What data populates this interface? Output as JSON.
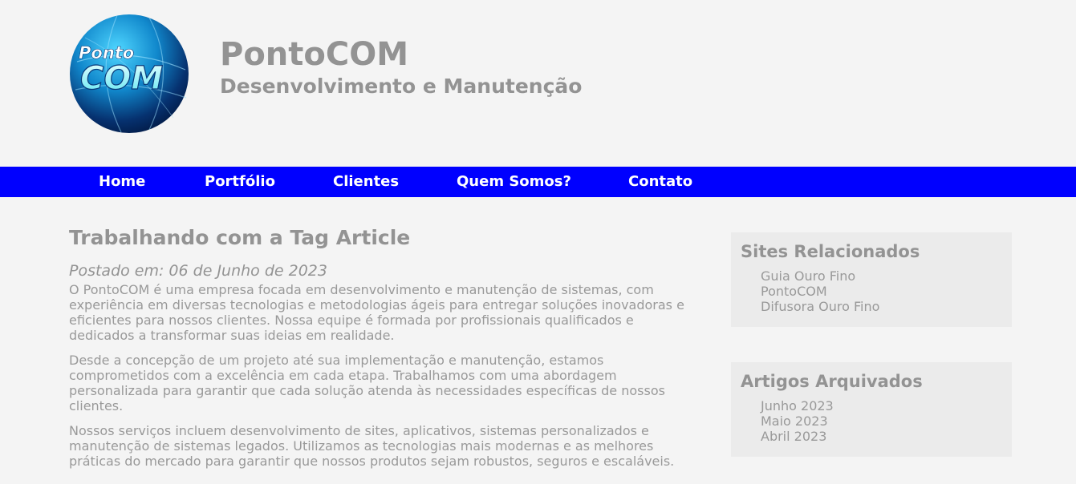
{
  "header": {
    "logo": {
      "line1": "Ponto",
      "line2": "COM"
    },
    "title": "PontoCOM",
    "subtitle": "Desenvolvimento e Manutenção"
  },
  "nav": {
    "items": [
      {
        "label": "Home"
      },
      {
        "label": "Portfólio"
      },
      {
        "label": "Clientes"
      },
      {
        "label": "Quem Somos?"
      },
      {
        "label": "Contato"
      }
    ]
  },
  "article": {
    "title": "Trabalhando com a Tag Article",
    "posted": "Postado em: 06 de Junho de 2023",
    "paragraphs": [
      "O PontoCOM é uma empresa focada em desenvolvimento e manutenção de sistemas, com experiência em diversas tecnologias e metodologias ágeis para entregar soluções inovadoras e eficientes para nossos clientes. Nossa equipe é formada por profissionais qualificados e dedicados a transformar suas ideias em realidade.",
      "Desde a concepção de um projeto até sua implementação e manutenção, estamos comprometidos com a excelência em cada etapa. Trabalhamos com uma abordagem personalizada para garantir que cada solução atenda às necessidades específicas de nossos clientes.",
      "Nossos serviços incluem desenvolvimento de sites, aplicativos, sistemas personalizados e manutenção de sistemas legados. Utilizamos as tecnologias mais modernas e as melhores práticas do mercado para garantir que nossos produtos sejam robustos, seguros e escaláveis."
    ]
  },
  "sidebar": {
    "related": {
      "title": "Sites Relacionados",
      "links": [
        "Guia Ouro Fino",
        "PontoCOM",
        "Difusora Ouro Fino"
      ]
    },
    "archive": {
      "title": "Artigos Arquivados",
      "links": [
        "Junho 2023",
        "Maio 2023",
        "Abril 2023"
      ]
    }
  },
  "colors": {
    "nav_background": "#0000ff",
    "page_background": "#f4f4f4",
    "text": "#999999",
    "widget_background": "#ebebeb"
  }
}
